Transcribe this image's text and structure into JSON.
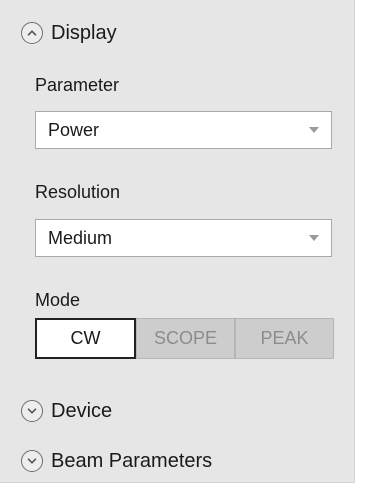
{
  "display_section": {
    "title": "Display",
    "expanded": true,
    "icon": "chevron-up-icon"
  },
  "parameter": {
    "label": "Parameter",
    "value": "Power"
  },
  "resolution": {
    "label": "Resolution",
    "value": "Medium"
  },
  "mode": {
    "label": "Mode",
    "options": [
      "CW",
      "SCOPE",
      "PEAK"
    ],
    "selected": "CW"
  },
  "device_section": {
    "title": "Device",
    "expanded": false,
    "icon": "chevron-down-icon"
  },
  "beam_section": {
    "title": "Beam Parameters",
    "expanded": false,
    "icon": "chevron-down-icon"
  },
  "colors": {
    "panel_background": "#e6e6e6",
    "selected_mode_background": "#ffffff",
    "unselected_mode_background": "#cdcdcd",
    "unselected_mode_text": "#8c8c8c"
  }
}
